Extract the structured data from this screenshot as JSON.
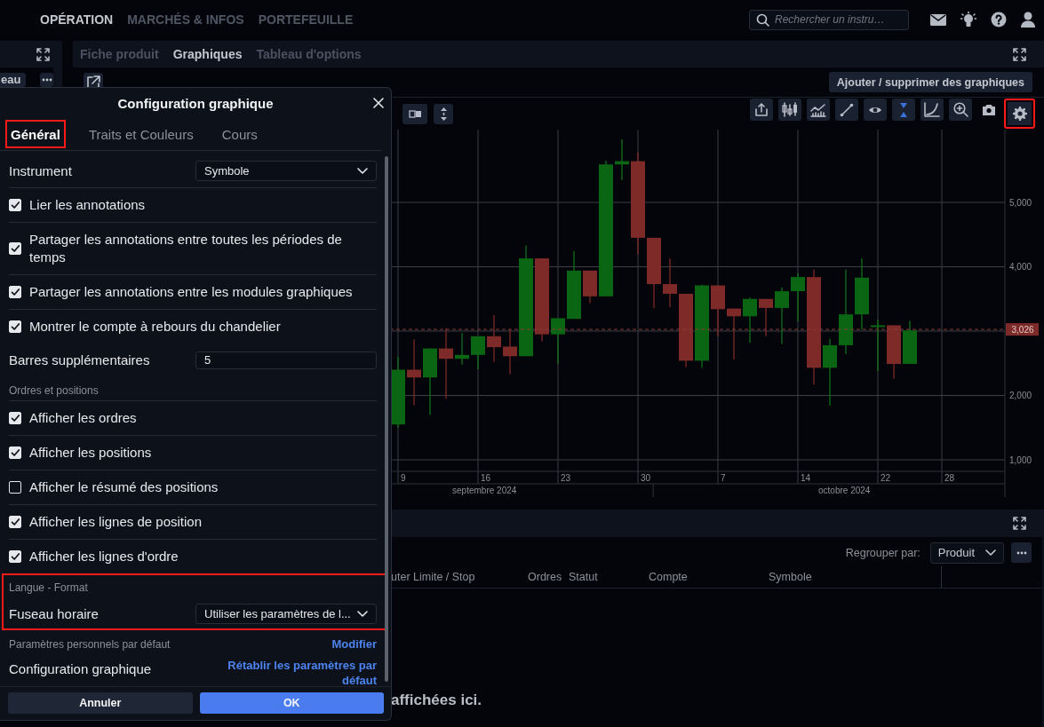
{
  "top_bar": {
    "nav": [
      {
        "label": "OPÉRATION",
        "selected": true
      },
      {
        "label": "MARCHÉS & INFOS",
        "selected": false
      },
      {
        "label": "PORTEFEUILLE",
        "selected": false
      }
    ],
    "search": {
      "placeholder": "Rechercher un instru…"
    }
  },
  "left_panel": {
    "button": "eau"
  },
  "chart_panel": {
    "tabs": [
      {
        "label": "Fiche produit",
        "selected": false
      },
      {
        "label": "Graphiques",
        "selected": true
      },
      {
        "label": "Tableau d'options",
        "selected": false
      }
    ],
    "add_button": "Ajouter / supprimer des graphiques",
    "left_tools": [
      {
        "kind": "bars"
      },
      {
        "kind": "height"
      }
    ],
    "tools": [
      {
        "kind": "share",
        "active": false,
        "highlighted": false
      },
      {
        "kind": "candles",
        "active": false,
        "highlighted": false
      },
      {
        "kind": "indicators",
        "active": false,
        "highlighted": false
      },
      {
        "kind": "draw",
        "active": false,
        "highlighted": false
      },
      {
        "kind": "eye",
        "active": false,
        "highlighted": false
      },
      {
        "kind": "fit",
        "active": true,
        "highlighted": false
      },
      {
        "kind": "curve",
        "active": false,
        "highlighted": false
      },
      {
        "kind": "zoom",
        "active": false,
        "highlighted": false
      },
      {
        "kind": "camera",
        "active": false,
        "highlighted": false
      },
      {
        "kind": "settings",
        "active": false,
        "highlighted": true
      }
    ],
    "chart": {
      "price_axis_labels": [
        "5,000",
        "4,000",
        "2,000",
        "1,000"
      ],
      "date_labels": [
        "9",
        "16",
        "23",
        "30",
        "7",
        "14",
        "22",
        "28"
      ],
      "months": [
        "septembre 2024",
        "octobre 2024"
      ],
      "last_price": "3,026"
    }
  },
  "dialog": {
    "title": "Configuration graphique",
    "tabs": [
      {
        "label": "Général",
        "selected": true,
        "highlighted": true
      },
      {
        "label": "Traits et Couleurs",
        "selected": false,
        "highlighted": false
      },
      {
        "label": "Cours",
        "selected": false,
        "highlighted": false
      }
    ],
    "groups": [
      {
        "highlighted": false,
        "rows": [
          {
            "kind": "select",
            "label": "Instrument",
            "value": "Symbole"
          },
          {
            "kind": "checkbox",
            "label": "Lier les annotations",
            "checked": true
          },
          {
            "kind": "checkbox",
            "label": "Partager les annotations entre toutes les périodes de temps",
            "checked": true
          },
          {
            "kind": "checkbox",
            "label": "Partager les annotations entre les modules graphiques",
            "checked": true
          },
          {
            "kind": "checkbox",
            "label": "Montrer le compte à rebours du chandelier",
            "checked": true
          },
          {
            "kind": "input",
            "label": "Barres supplémentaires",
            "value": "5"
          }
        ]
      },
      {
        "highlighted": false,
        "rows": [
          {
            "kind": "section",
            "label": "Ordres et positions"
          },
          {
            "kind": "checkbox",
            "label": "Afficher les ordres",
            "checked": true
          },
          {
            "kind": "checkbox",
            "label": "Afficher les positions",
            "checked": true
          },
          {
            "kind": "checkbox",
            "label": "Afficher le résumé des positions",
            "checked": false
          },
          {
            "kind": "checkbox",
            "label": "Afficher les lignes de position",
            "checked": true
          },
          {
            "kind": "checkbox",
            "label": "Afficher les lignes d'ordre",
            "checked": true
          }
        ]
      },
      {
        "highlighted": true,
        "rows": [
          {
            "kind": "section",
            "label": "Langue - Format"
          },
          {
            "kind": "select",
            "label": "Fuseau horaire",
            "value": "Utiliser les paramètres de l..."
          }
        ]
      },
      {
        "highlighted": false,
        "rows": [
          {
            "kind": "section",
            "label": "Paramètres personnels par défaut",
            "link": "Modifier"
          },
          {
            "kind": "action",
            "label": "Configuration graphique",
            "link": "Rétablir les paramètres par défaut"
          }
        ]
      }
    ],
    "cancel": "Annuler",
    "ok": "OK"
  },
  "orders_panel": {
    "group_label": "Regrouper par:",
    "group_value": "Produit",
    "columns": [
      "uter Limite / Stop",
      "Ordres",
      "Statut",
      "Compte",
      "Symbole"
    ],
    "empty_message": "affichées ici."
  }
}
